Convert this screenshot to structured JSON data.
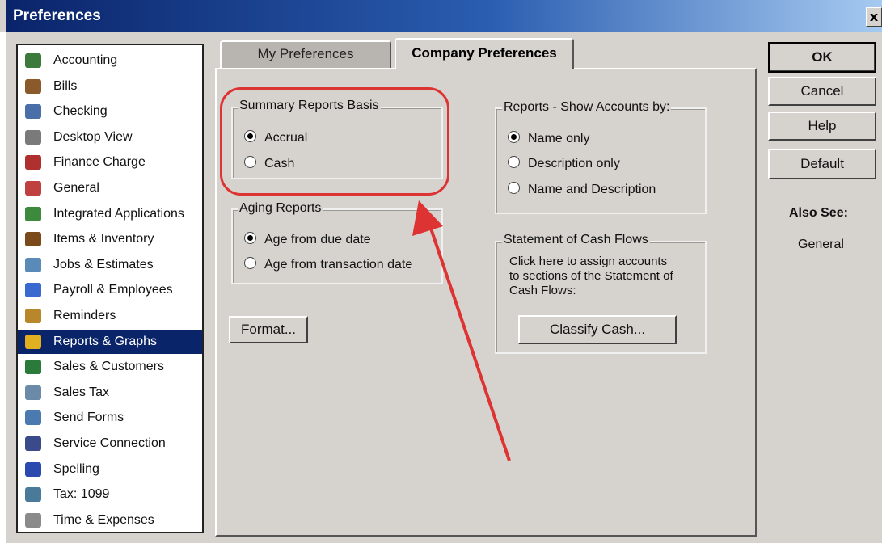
{
  "window": {
    "title": "Preferences",
    "close_label": "x"
  },
  "categories": [
    {
      "label": "Accounting",
      "icon": "accounting-icon",
      "color": "#3c7a3c"
    },
    {
      "label": "Bills",
      "icon": "bills-icon",
      "color": "#8a5a2b"
    },
    {
      "label": "Checking",
      "icon": "checking-icon",
      "color": "#4a6fa8"
    },
    {
      "label": "Desktop View",
      "icon": "desktop-view-icon",
      "color": "#7a7a7a"
    },
    {
      "label": "Finance Charge",
      "icon": "finance-charge-icon",
      "color": "#b03030"
    },
    {
      "label": "General",
      "icon": "general-icon",
      "color": "#c04040"
    },
    {
      "label": "Integrated Applications",
      "icon": "integrated-applications-icon",
      "color": "#3c8a3c"
    },
    {
      "label": "Items & Inventory",
      "icon": "items-inventory-icon",
      "color": "#7a4a1a"
    },
    {
      "label": "Jobs & Estimates",
      "icon": "jobs-estimates-icon",
      "color": "#5a8ab8"
    },
    {
      "label": "Payroll & Employees",
      "icon": "payroll-employees-icon",
      "color": "#3a6ad0"
    },
    {
      "label": "Reminders",
      "icon": "reminders-icon",
      "color": "#b8862b"
    },
    {
      "label": "Reports & Graphs",
      "icon": "reports-graphs-icon",
      "color": "#e0b020",
      "selected": true
    },
    {
      "label": "Sales & Customers",
      "icon": "sales-customers-icon",
      "color": "#2a7a3a"
    },
    {
      "label": "Sales Tax",
      "icon": "sales-tax-icon",
      "color": "#6a8aa8"
    },
    {
      "label": "Send Forms",
      "icon": "send-forms-icon",
      "color": "#4a7ab0"
    },
    {
      "label": "Service Connection",
      "icon": "service-connection-icon",
      "color": "#3a4a8a"
    },
    {
      "label": "Spelling",
      "icon": "spelling-icon",
      "color": "#2a4ab0"
    },
    {
      "label": "Tax: 1099",
      "icon": "tax-1099-icon",
      "color": "#4a7a9a"
    },
    {
      "label": "Time & Expenses",
      "icon": "time-expenses-icon",
      "color": "#8a8a8a"
    }
  ],
  "tabs": {
    "my": "My Preferences",
    "company": "Company Preferences"
  },
  "summary": {
    "title": "Summary Reports Basis",
    "options": [
      "Accrual",
      "Cash"
    ],
    "selected": "Accrual"
  },
  "aging": {
    "title": "Aging Reports",
    "options": [
      "Age from due date",
      "Age from transaction date"
    ],
    "selected": "Age from due date"
  },
  "show_accounts": {
    "title": "Reports - Show Accounts by:",
    "options": [
      "Name only",
      "Description only",
      "Name and Description"
    ],
    "selected": "Name only"
  },
  "cash_flows": {
    "title": "Statement of Cash Flows",
    "text_lines": [
      "Click here to assign accounts",
      "to sections of the Statement of",
      "Cash Flows:"
    ],
    "button": "Classify Cash..."
  },
  "format_button": "Format...",
  "buttons": {
    "ok": "OK",
    "cancel": "Cancel",
    "help": "Help",
    "default": "Default"
  },
  "also_see": {
    "title": "Also See:",
    "link": "General"
  },
  "colors": {
    "highlight": "#dd3333",
    "selection": "#0a246a",
    "titlebar": "#0a246a"
  }
}
